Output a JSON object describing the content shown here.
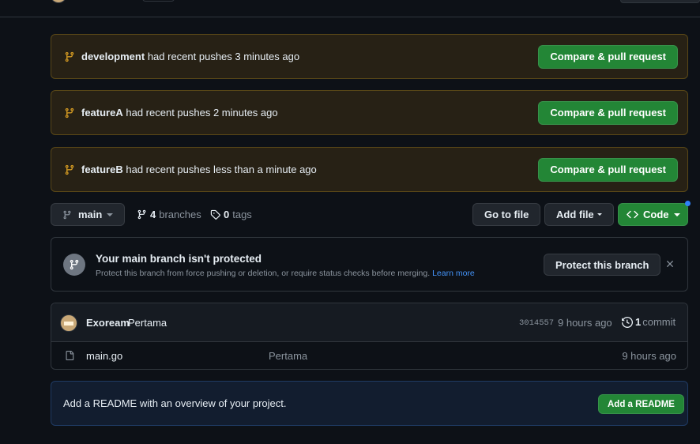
{
  "colors": {
    "background": "#0d1117",
    "accent_green": "#238636",
    "banner_bg": "#272115",
    "banner_border": "#5a4817",
    "link_blue": "#4493f8",
    "branch_icon": "#d29922"
  },
  "push_banners": [
    {
      "branch": "development",
      "message": "had recent pushes 3 minutes ago",
      "button": "Compare & pull request"
    },
    {
      "branch": "featureA",
      "message": "had recent pushes 2 minutes ago",
      "button": "Compare & pull request"
    },
    {
      "branch": "featureB",
      "message": "had recent pushes less than a minute ago",
      "button": "Compare & pull request"
    }
  ],
  "toolbar": {
    "branch": "main",
    "branches_count": "4",
    "branches_label": "branches",
    "tags_count": "0",
    "tags_label": "tags",
    "goto_file": "Go to file",
    "add_file": "Add file",
    "code": "Code"
  },
  "protect": {
    "title": "Your main branch isn't protected",
    "description": "Protect this branch from force pushing or deletion, or require status checks before merging.",
    "learn_more": "Learn more",
    "button": "Protect this branch"
  },
  "latest_commit": {
    "author": "Exoream",
    "message": "Pertama",
    "sha": "3014557",
    "time": "9 hours ago",
    "commit_count": "1",
    "commit_label": "commit"
  },
  "files": [
    {
      "name": "main.go",
      "commit_message": "Pertama",
      "time": "9 hours ago"
    }
  ],
  "readme": {
    "text": "Add a README with an overview of your project.",
    "button": "Add a README"
  }
}
